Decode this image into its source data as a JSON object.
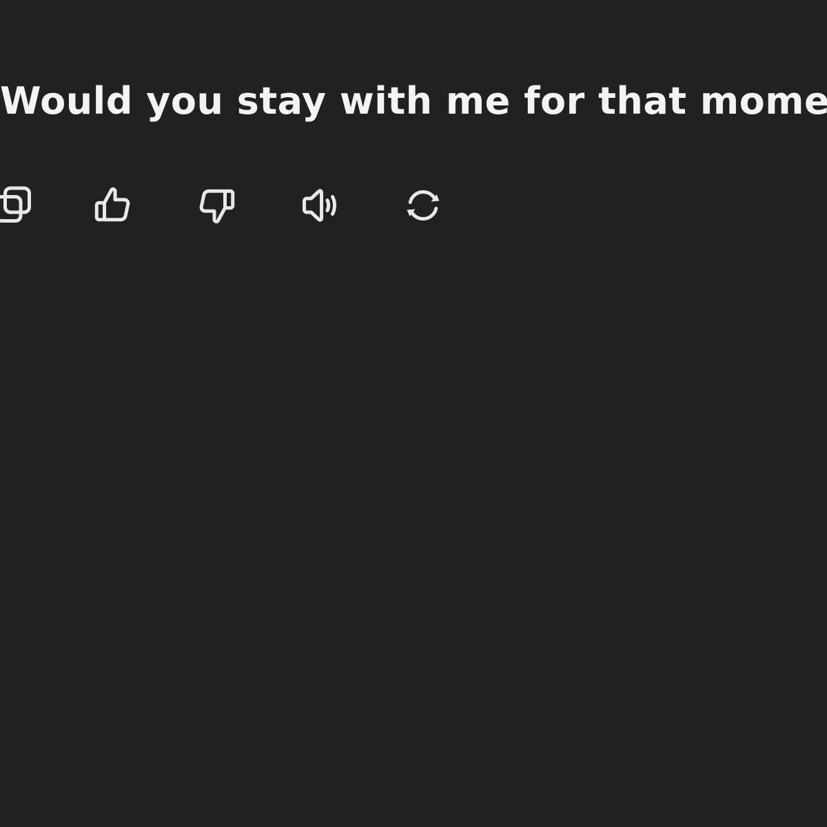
{
  "message": {
    "text": "Would you stay with me for that moment?"
  },
  "actions": [
    {
      "name": "copy",
      "icon": "copy-icon"
    },
    {
      "name": "good-response",
      "icon": "thumbs-up-icon"
    },
    {
      "name": "bad-response",
      "icon": "thumbs-down-icon"
    },
    {
      "name": "read-aloud",
      "icon": "speaker-icon"
    },
    {
      "name": "regenerate",
      "icon": "refresh-icon"
    }
  ],
  "colors": {
    "background": "#212121",
    "text": "#f3f3f3",
    "icon": "#e8e8e8"
  }
}
